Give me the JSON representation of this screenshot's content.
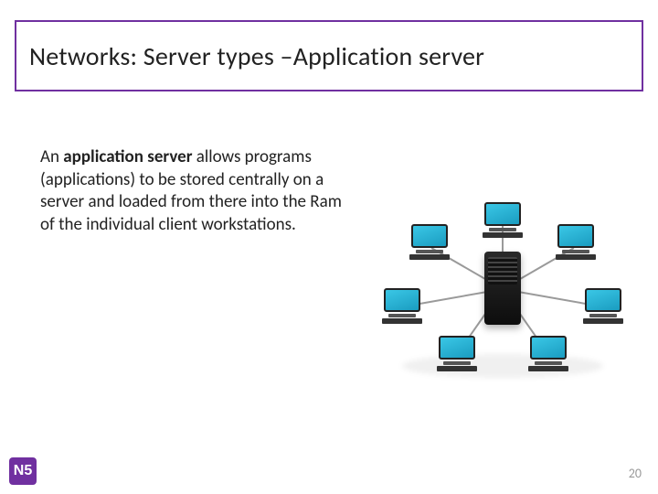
{
  "title": "Networks: Server types –Application server",
  "body": {
    "prefix": "An ",
    "bold": "application server",
    "rest": " allows programs (applications) to be stored centrally on a server and loaded from there into the Ram of the individual client workstations."
  },
  "logo_text": "N5",
  "page_number": "20",
  "colors": {
    "accent": "#7030a0"
  }
}
